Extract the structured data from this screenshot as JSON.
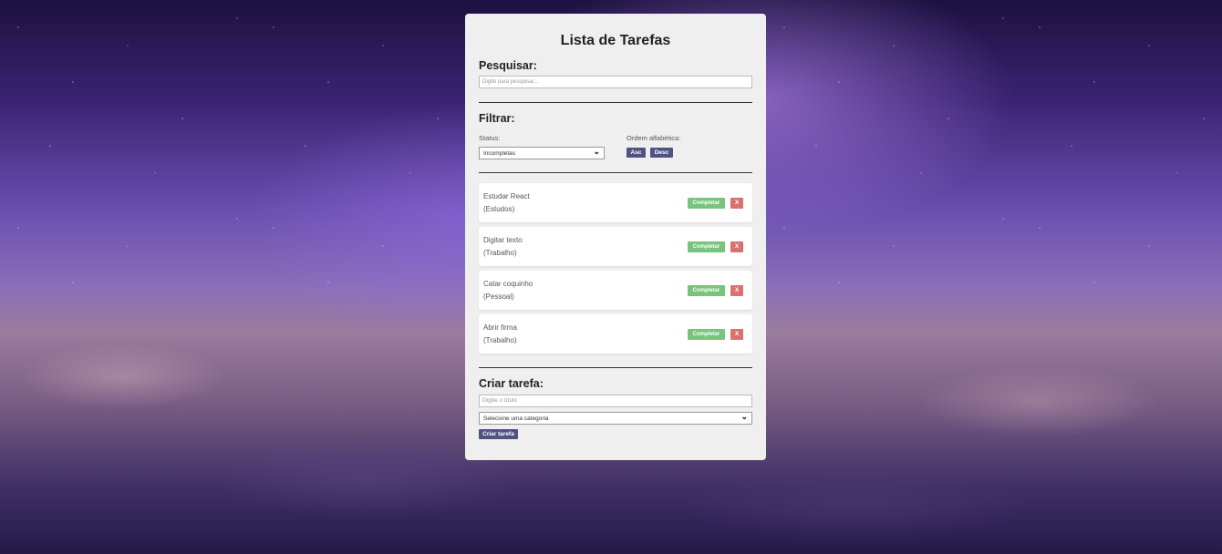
{
  "app": {
    "title": "Lista de Tarefas"
  },
  "search": {
    "heading": "Pesquisar:",
    "placeholder": "Digite para pesquisar..."
  },
  "filter": {
    "heading": "Filtrar:",
    "status_label": "Status:",
    "status_selected": "Incompletas",
    "sort_label": "Ordem alfabética:",
    "asc_label": "Asc",
    "desc_label": "Desc"
  },
  "tasks": [
    {
      "title": "Estudar React",
      "category": "(Estudos)",
      "complete_label": "Completar",
      "delete_label": "X"
    },
    {
      "title": "Digitar texto",
      "category": "(Trabalho)",
      "complete_label": "Completar",
      "delete_label": "X"
    },
    {
      "title": "Catar coquinho",
      "category": "(Pessoal)",
      "complete_label": "Completar",
      "delete_label": "X"
    },
    {
      "title": "Abrir firma",
      "category": "(Trabalho)",
      "complete_label": "Completar",
      "delete_label": "X"
    }
  ],
  "create": {
    "heading": "Criar tarefa:",
    "title_placeholder": "Digite o título",
    "category_placeholder": "Selecione uma categoria",
    "submit_label": "Criar tarefa"
  },
  "colors": {
    "panel_bg": "#efefef",
    "primary_button": "#4f5383",
    "complete_button": "#78c47c",
    "delete_button": "#d9716f"
  },
  "icons": {
    "select_chevron": "chevron-down-icon"
  }
}
